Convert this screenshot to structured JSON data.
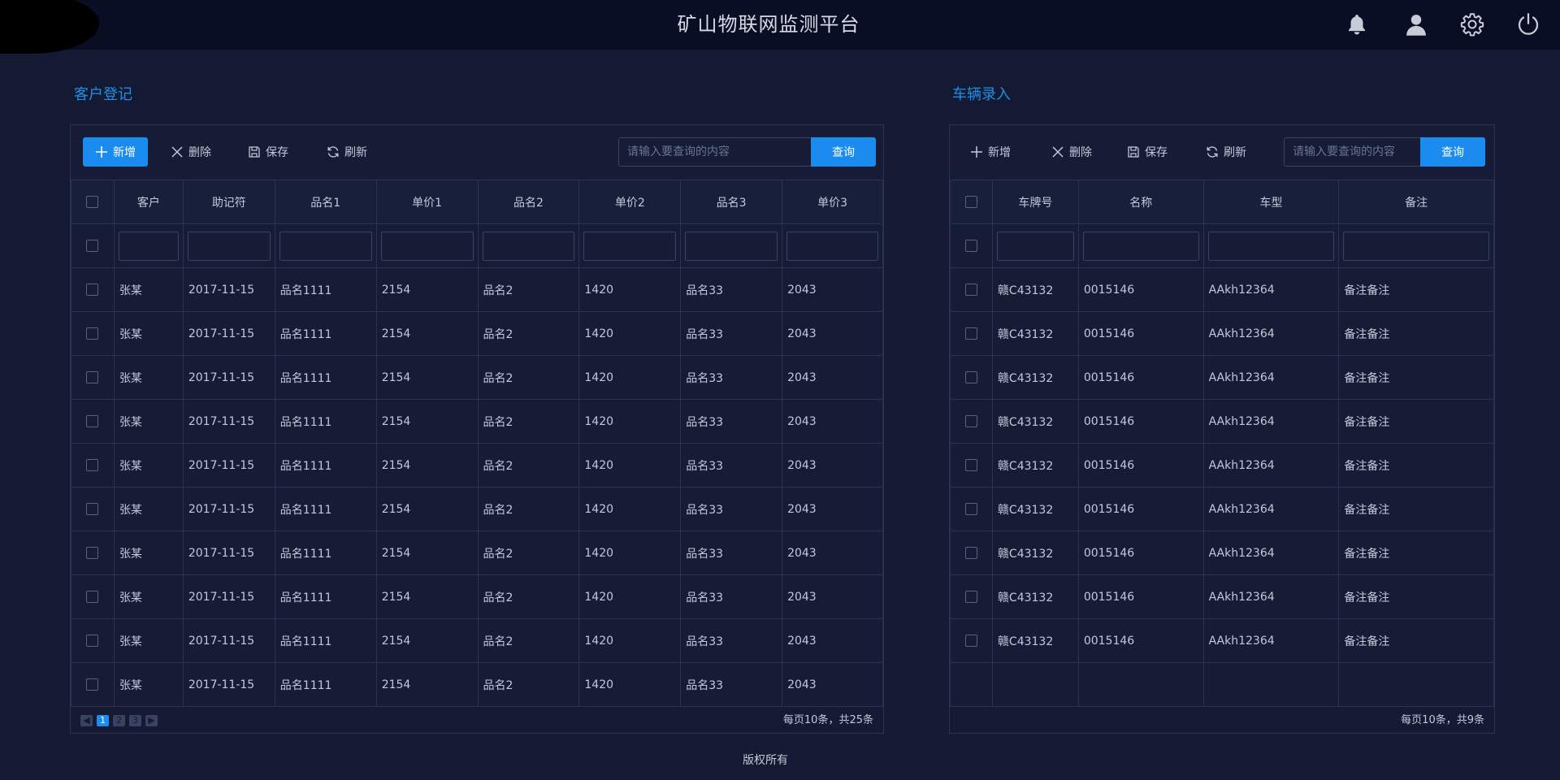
{
  "app": {
    "title": "矿山物联网监测平台",
    "accent_color": "#1a8cf0",
    "header_icons": [
      "bell-icon",
      "user-icon",
      "gear-icon",
      "power-icon"
    ]
  },
  "customer": {
    "title": "客户登记",
    "toolbar": {
      "add": "新增",
      "delete": "删除",
      "save": "保存",
      "refresh": "刷新"
    },
    "search": {
      "placeholder": "请输入要查询的内容",
      "button": "查询"
    },
    "columns": [
      "客户",
      "助记符",
      "品名1",
      "单价1",
      "品名2",
      "单价2",
      "品名3",
      "单价3"
    ],
    "rows": [
      [
        "张某",
        "2017-11-15",
        "品名1111",
        "2154",
        "品名2",
        "1420",
        "品名33",
        "2043"
      ],
      [
        "张某",
        "2017-11-15",
        "品名1111",
        "2154",
        "品名2",
        "1420",
        "品名33",
        "2043"
      ],
      [
        "张某",
        "2017-11-15",
        "品名1111",
        "2154",
        "品名2",
        "1420",
        "品名33",
        "2043"
      ],
      [
        "张某",
        "2017-11-15",
        "品名1111",
        "2154",
        "品名2",
        "1420",
        "品名33",
        "2043"
      ],
      [
        "张某",
        "2017-11-15",
        "品名1111",
        "2154",
        "品名2",
        "1420",
        "品名33",
        "2043"
      ],
      [
        "张某",
        "2017-11-15",
        "品名1111",
        "2154",
        "品名2",
        "1420",
        "品名33",
        "2043"
      ],
      [
        "张某",
        "2017-11-15",
        "品名1111",
        "2154",
        "品名2",
        "1420",
        "品名33",
        "2043"
      ],
      [
        "张某",
        "2017-11-15",
        "品名1111",
        "2154",
        "品名2",
        "1420",
        "品名33",
        "2043"
      ],
      [
        "张某",
        "2017-11-15",
        "品名1111",
        "2154",
        "品名2",
        "1420",
        "品名33",
        "2043"
      ],
      [
        "张某",
        "2017-11-15",
        "品名1111",
        "2154",
        "品名2",
        "1420",
        "品名33",
        "2043"
      ]
    ],
    "pager": {
      "pages": [
        "1",
        "2",
        "3"
      ],
      "current": "1",
      "info": "每页10条，共25条"
    }
  },
  "vehicle": {
    "title": "车辆录入",
    "toolbar": {
      "add": "新增",
      "delete": "删除",
      "save": "保存",
      "refresh": "刷新"
    },
    "search": {
      "placeholder": "请输入要查询的内容",
      "button": "查询"
    },
    "columns": [
      "车牌号",
      "名称",
      "车型",
      "备注"
    ],
    "rows": [
      [
        "赣C43132",
        "0015146",
        "AAkh12364",
        "备注备注"
      ],
      [
        "赣C43132",
        "0015146",
        "AAkh12364",
        "备注备注"
      ],
      [
        "赣C43132",
        "0015146",
        "AAkh12364",
        "备注备注"
      ],
      [
        "赣C43132",
        "0015146",
        "AAkh12364",
        "备注备注"
      ],
      [
        "赣C43132",
        "0015146",
        "AAkh12364",
        "备注备注"
      ],
      [
        "赣C43132",
        "0015146",
        "AAkh12364",
        "备注备注"
      ],
      [
        "赣C43132",
        "0015146",
        "AAkh12364",
        "备注备注"
      ],
      [
        "赣C43132",
        "0015146",
        "AAkh12364",
        "备注备注"
      ],
      [
        "赣C43132",
        "0015146",
        "AAkh12364",
        "备注备注"
      ]
    ],
    "empty_rows": 1,
    "pager": {
      "info": "每页10条，共9条"
    }
  },
  "footer": {
    "copyright": "版权所有"
  }
}
